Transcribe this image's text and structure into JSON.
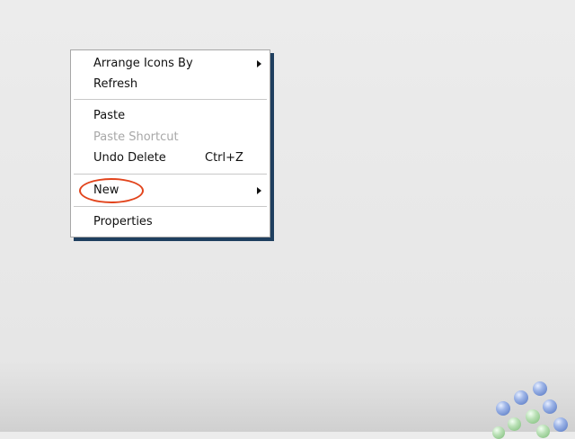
{
  "context_menu": {
    "items": [
      {
        "label": "Arrange Icons By",
        "submenu": true
      },
      {
        "label": "Refresh"
      },
      {
        "label": "Paste"
      },
      {
        "label": "Paste Shortcut",
        "disabled": true
      },
      {
        "label": "Undo Delete",
        "shortcut": "Ctrl+Z"
      },
      {
        "label": "New",
        "submenu": true,
        "highlighted": true
      },
      {
        "label": "Properties"
      }
    ]
  },
  "colors": {
    "highlight_oval": "#e2441c",
    "menu_shadow": "#1f3f5f",
    "disabled_text": "#a8a8a8"
  }
}
